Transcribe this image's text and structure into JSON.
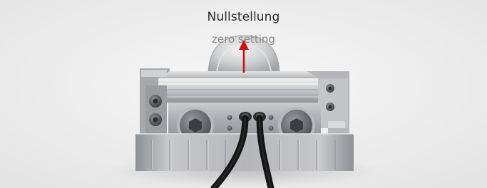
{
  "caption": {
    "title": "Nullstellung",
    "subtitle": "zero setting"
  },
  "arrow": {
    "color": "#cc1111",
    "direction": "up"
  },
  "image": {
    "subject": "metal sensor clamp with round housing and two cables",
    "background_color": "#efefef"
  }
}
